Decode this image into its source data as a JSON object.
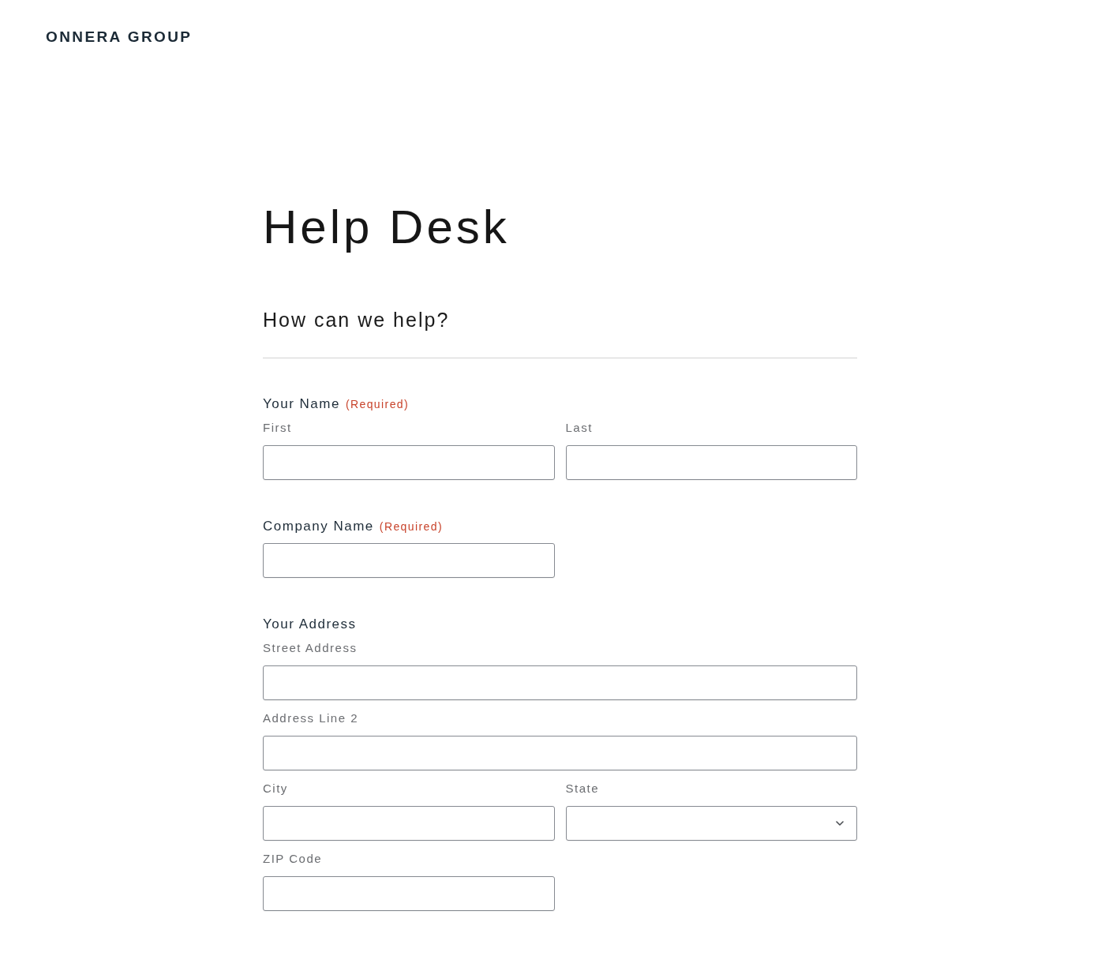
{
  "header": {
    "logo": "ONNERA GROUP"
  },
  "page": {
    "title": "Help Desk",
    "subtitle": "How can we help?"
  },
  "form": {
    "fieldsets": [
      {
        "legend": "Your Name",
        "required_note": "(Required)",
        "fields": [
          {
            "label": "First",
            "kind": "text"
          },
          {
            "label": "Last",
            "kind": "text"
          }
        ]
      },
      {
        "legend": "Company Name",
        "required_note": "(Required)",
        "fields": [
          {
            "kind": "text"
          }
        ]
      },
      {
        "legend": "Your Address",
        "fields": [
          {
            "label": "Street Address",
            "kind": "text"
          },
          {
            "label": "Address Line 2",
            "kind": "text"
          },
          {
            "label": "City",
            "kind": "text"
          },
          {
            "label": "State",
            "kind": "select"
          },
          {
            "label": "ZIP Code",
            "kind": "text"
          }
        ]
      }
    ]
  }
}
